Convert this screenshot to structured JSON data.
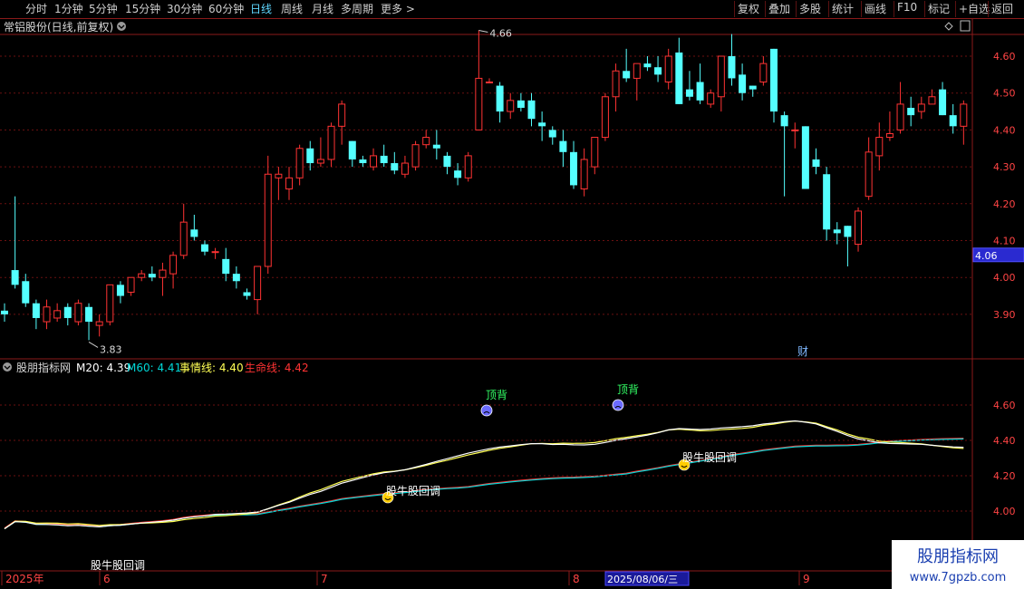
{
  "toolbar": {
    "left": [
      "分时",
      "1分钟",
      "5分钟",
      "15分钟",
      "30分钟",
      "60分钟",
      "日线",
      "周线",
      "月线",
      "多周期",
      "更多"
    ],
    "active": "日线",
    "right": [
      "复权",
      "叠加",
      "多股",
      "统计",
      "画线",
      "F10",
      "标记",
      "+自选",
      "返回"
    ]
  },
  "main": {
    "title": "常铝股份(日线,前复权)",
    "current_price": "4.06",
    "y_ticks": [
      "4.60",
      "4.50",
      "4.40",
      "4.30",
      "4.20",
      "4.10",
      "4.00",
      "3.90"
    ],
    "high_label": "4.66",
    "low_label": "3.83",
    "fin_marker": "财"
  },
  "indicator": {
    "name": "股朋指标网",
    "legend": [
      {
        "label": "M20: 4.39",
        "color": "#ffffff"
      },
      {
        "label": "M60: 4.41",
        "color": "#00d6d6"
      },
      {
        "label": "事情线: 4.40",
        "color": "#ffff55"
      },
      {
        "label": "生命线: 4.42",
        "color": "#ff3333"
      }
    ],
    "y_ticks": [
      "4.60",
      "4.40",
      "4.20",
      "4.00"
    ],
    "signals": [
      {
        "text": "顶背",
        "type": "top"
      },
      {
        "text": "顶背",
        "type": "top"
      },
      {
        "text": "股牛股回调",
        "type": "pullback"
      },
      {
        "text": "股牛股回调",
        "type": "pullback"
      },
      {
        "text": "股牛股回调",
        "type": "pullback"
      }
    ]
  },
  "date_axis": {
    "labels": [
      "2025年",
      "6",
      "7",
      "8",
      "9"
    ],
    "cursor_date": "2025/08/06/三"
  },
  "watermark": {
    "title": "股朋指标网",
    "url": "www.7gpzb.com"
  },
  "colors": {
    "up": "#ff3333",
    "down": "#54ffff",
    "m20": "#ffffff",
    "m60": "#00d6d6",
    "shiqing": "#ffff55",
    "shengming": "#ff3333",
    "grid": "#6b1010",
    "axis": "#8b1a1a"
  },
  "chart_data": {
    "type": "candlestick",
    "ohlc": [
      [
        3.91,
        3.93,
        3.88,
        3.9
      ],
      [
        4.02,
        4.22,
        3.97,
        3.98
      ],
      [
        3.99,
        4.01,
        3.92,
        3.93
      ],
      [
        3.93,
        3.94,
        3.86,
        3.89
      ],
      [
        3.88,
        3.94,
        3.86,
        3.92
      ],
      [
        3.89,
        3.93,
        3.88,
        3.91
      ],
      [
        3.92,
        3.93,
        3.87,
        3.89
      ],
      [
        3.88,
        3.94,
        3.87,
        3.93
      ],
      [
        3.92,
        3.93,
        3.83,
        3.88
      ],
      [
        3.87,
        3.9,
        3.84,
        3.88
      ],
      [
        3.88,
        3.98,
        3.87,
        3.98
      ],
      [
        3.98,
        3.99,
        3.93,
        3.95
      ],
      [
        3.96,
        4.0,
        3.95,
        4.0
      ],
      [
        4.0,
        4.02,
        3.99,
        4.01
      ],
      [
        4.01,
        4.03,
        3.99,
        4.0
      ],
      [
        4.0,
        4.04,
        3.95,
        4.02
      ],
      [
        4.01,
        4.07,
        3.97,
        4.06
      ],
      [
        4.06,
        4.2,
        4.05,
        4.15
      ],
      [
        4.13,
        4.17,
        4.1,
        4.11
      ],
      [
        4.09,
        4.1,
        4.06,
        4.07
      ],
      [
        4.07,
        4.08,
        4.05,
        4.07
      ],
      [
        4.05,
        4.08,
        3.99,
        4.01
      ],
      [
        4.01,
        4.03,
        3.97,
        3.99
      ],
      [
        3.96,
        3.97,
        3.94,
        3.95
      ],
      [
        3.94,
        4.03,
        3.9,
        4.03
      ],
      [
        4.03,
        4.33,
        4.01,
        4.28
      ],
      [
        4.27,
        4.3,
        4.21,
        4.28
      ],
      [
        4.24,
        4.3,
        4.21,
        4.27
      ],
      [
        4.27,
        4.36,
        4.25,
        4.35
      ],
      [
        4.35,
        4.37,
        4.29,
        4.31
      ],
      [
        4.31,
        4.38,
        4.3,
        4.32
      ],
      [
        4.32,
        4.42,
        4.3,
        4.41
      ],
      [
        4.41,
        4.48,
        4.36,
        4.47
      ],
      [
        4.37,
        4.37,
        4.3,
        4.32
      ],
      [
        4.32,
        4.33,
        4.3,
        4.31
      ],
      [
        4.3,
        4.35,
        4.29,
        4.33
      ],
      [
        4.33,
        4.36,
        4.3,
        4.31
      ],
      [
        4.31,
        4.34,
        4.28,
        4.29
      ],
      [
        4.28,
        4.33,
        4.27,
        4.31
      ],
      [
        4.3,
        4.37,
        4.29,
        4.36
      ],
      [
        4.36,
        4.4,
        4.35,
        4.38
      ],
      [
        4.36,
        4.4,
        4.32,
        4.35
      ],
      [
        4.33,
        4.34,
        4.28,
        4.3
      ],
      [
        4.29,
        4.31,
        4.25,
        4.27
      ],
      [
        4.27,
        4.34,
        4.26,
        4.33
      ],
      [
        4.4,
        4.67,
        4.4,
        4.54
      ],
      [
        4.53,
        4.54,
        4.53,
        4.53
      ],
      [
        4.52,
        4.53,
        4.42,
        4.45
      ],
      [
        4.45,
        4.5,
        4.43,
        4.48
      ],
      [
        4.48,
        4.5,
        4.45,
        4.46
      ],
      [
        4.48,
        4.5,
        4.41,
        4.43
      ],
      [
        4.42,
        4.45,
        4.37,
        4.41
      ],
      [
        4.4,
        4.41,
        4.36,
        4.38
      ],
      [
        4.37,
        4.4,
        4.3,
        4.34
      ],
      [
        4.34,
        4.37,
        4.24,
        4.25
      ],
      [
        4.24,
        4.35,
        4.22,
        4.32
      ],
      [
        4.3,
        4.38,
        4.28,
        4.38
      ],
      [
        4.38,
        4.5,
        4.37,
        4.49
      ],
      [
        4.49,
        4.58,
        4.45,
        4.56
      ],
      [
        4.56,
        4.62,
        4.53,
        4.54
      ],
      [
        4.54,
        4.58,
        4.48,
        4.58
      ],
      [
        4.58,
        4.6,
        4.56,
        4.57
      ],
      [
        4.57,
        4.6,
        4.53,
        4.55
      ],
      [
        4.53,
        4.62,
        4.51,
        4.6
      ],
      [
        4.61,
        4.65,
        4.47,
        4.47
      ],
      [
        4.51,
        4.56,
        4.48,
        4.49
      ],
      [
        4.53,
        4.58,
        4.47,
        4.48
      ],
      [
        4.47,
        4.51,
        4.46,
        4.5
      ],
      [
        4.49,
        4.56,
        4.45,
        4.6
      ],
      [
        4.6,
        4.66,
        4.52,
        4.54
      ],
      [
        4.55,
        4.58,
        4.48,
        4.5
      ],
      [
        4.52,
        4.52,
        4.49,
        4.51
      ],
      [
        4.53,
        4.6,
        4.52,
        4.58
      ],
      [
        4.62,
        4.62,
        4.42,
        4.45
      ],
      [
        4.44,
        4.45,
        4.22,
        4.41
      ],
      [
        4.4,
        4.42,
        4.35,
        4.4
      ],
      [
        4.41,
        4.41,
        4.24,
        4.24
      ],
      [
        4.32,
        4.35,
        4.28,
        4.3
      ],
      [
        4.28,
        4.3,
        4.1,
        4.13
      ],
      [
        4.13,
        4.15,
        4.09,
        4.12
      ],
      [
        4.14,
        4.14,
        4.03,
        4.11
      ],
      [
        4.09,
        4.19,
        4.07,
        4.18
      ],
      [
        4.22,
        4.38,
        4.21,
        4.34
      ],
      [
        4.33,
        4.42,
        4.29,
        4.38
      ],
      [
        4.38,
        4.45,
        4.37,
        4.39
      ],
      [
        4.4,
        4.53,
        4.39,
        4.47
      ],
      [
        4.46,
        4.49,
        4.41,
        4.44
      ],
      [
        4.45,
        4.49,
        4.43,
        4.47
      ],
      [
        4.47,
        4.51,
        4.47,
        4.49
      ],
      [
        4.51,
        4.53,
        4.44,
        4.44
      ],
      [
        4.44,
        4.47,
        4.39,
        4.41
      ],
      [
        4.41,
        4.48,
        4.36,
        4.47
      ]
    ],
    "ylim": [
      3.86,
      4.7
    ],
    "indicator_ylim": [
      3.9,
      4.7
    ]
  }
}
